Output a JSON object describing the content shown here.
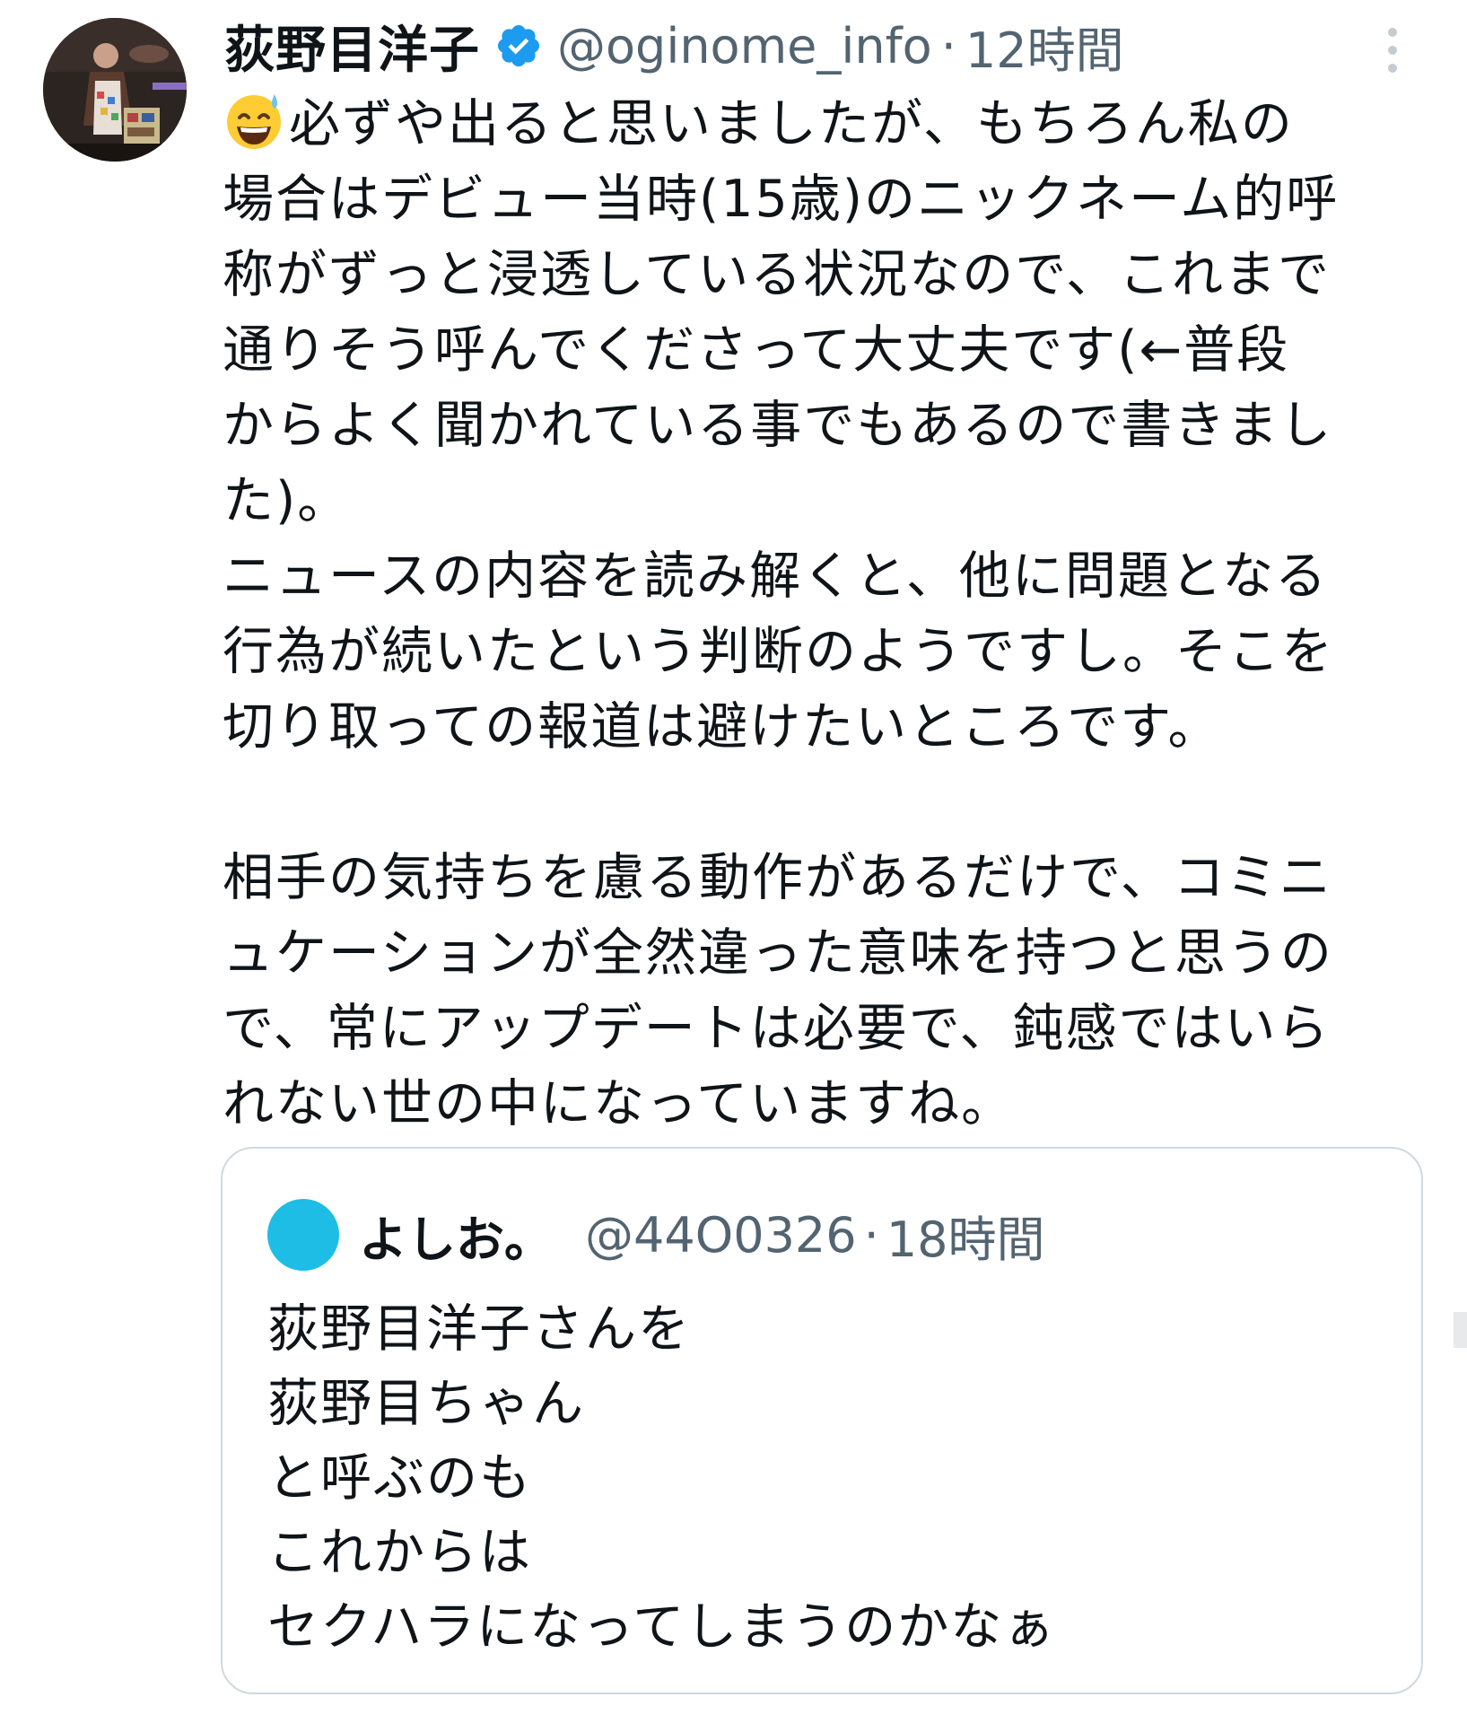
{
  "tweet": {
    "author": {
      "display_name": "荻野目洋子",
      "handle": "@oginome_info",
      "verified": true
    },
    "separator": "·",
    "time": "12時間",
    "emoji": "sweat-smile-emoji",
    "body_lines": [
      "必ずや出ると思いましたが、もちろん私の",
      "場合はデビュー当時(15歳)のニックネーム的呼",
      "称がずっと浸透している状況なので、これまで",
      "通りそう呼んでくださって大丈夫です(←普段",
      "からよく聞かれている事でもあるので書きまし",
      "た)。",
      "ニュースの内容を読み解くと、他に問題となる",
      "行為が続いたという判断のようですし。そこを",
      "切り取っての報道は避けたいところです。",
      "",
      "相手の気持ちを慮る動作があるだけで、コミニ",
      "ュケーションが全然違った意味を持つと思うの",
      "で、常にアップデートは必要で、鈍感ではいら",
      "れない世の中になっていますね。"
    ]
  },
  "quoted_tweet": {
    "author": {
      "display_name": "よしお。",
      "handle": "@44O0326"
    },
    "separator": "·",
    "time": "18時間",
    "avatar_color": "#1dbde6",
    "body_lines": [
      "荻野目洋子さんを",
      "荻野目ちゃん",
      "と呼ぶのも",
      "これからは",
      "セクハラになってしまうのかなぁ"
    ]
  },
  "colors": {
    "text": "#0f1419",
    "secondary": "#536471",
    "verified": "#1d9bf0",
    "border": "#cfd9de"
  }
}
